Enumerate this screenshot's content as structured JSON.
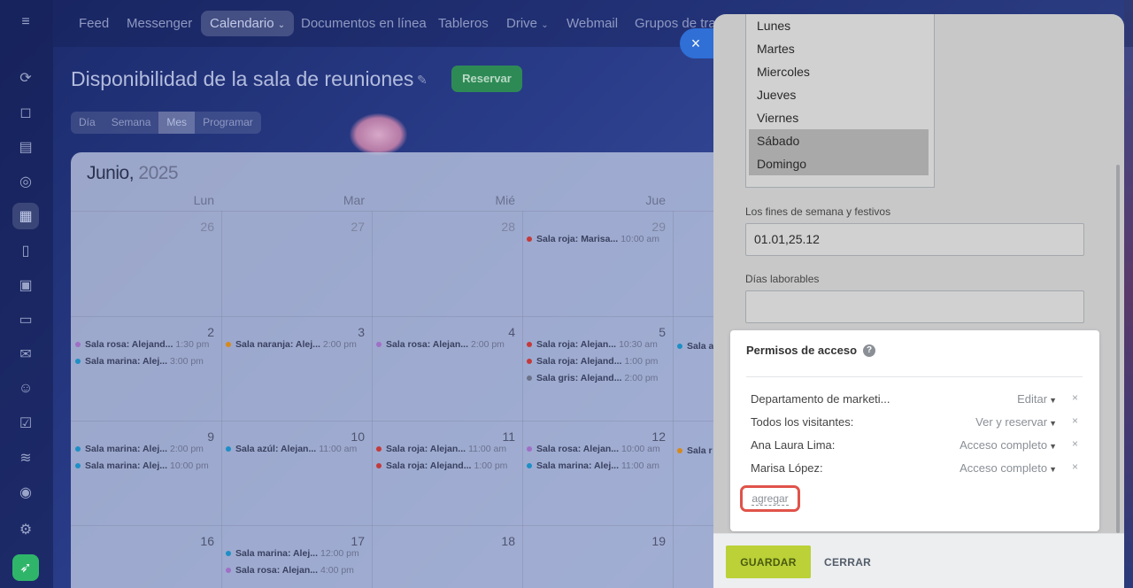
{
  "nav": {
    "items": [
      "Feed",
      "Messenger",
      "Calendario",
      "Documentos en línea",
      "Tableros",
      "Drive",
      "Webmail",
      "Grupos de tra"
    ],
    "active": "Calendario"
  },
  "page": {
    "title": "Disponibilidad de la sala de reuniones",
    "reserve_label": "Reservar",
    "view_tabs": [
      "Día",
      "Semana",
      "Mes",
      "Programar"
    ],
    "active_view": "Mes"
  },
  "calendar": {
    "month": "Junio,",
    "year": "2025",
    "day_headers": [
      "Lun",
      "Mar",
      "Mié",
      "Jue"
    ],
    "colors": {
      "rosa": "#a06fc6",
      "marina": "#1d8fc6",
      "naranja": "#d68a1c",
      "roja": "#c43a3a",
      "azul": "#1d8fc6",
      "gris": "#6a7388"
    },
    "weeks": [
      {
        "days": [
          {
            "num": "26",
            "events": []
          },
          {
            "num": "27",
            "events": []
          },
          {
            "num": "28",
            "events": []
          },
          {
            "num": "29",
            "events": [
              {
                "color": "roja",
                "name": "Sala roja: Marisa...",
                "time": "10:00 am"
              }
            ]
          }
        ]
      },
      {
        "days": [
          {
            "num": "2",
            "events": [
              {
                "color": "rosa",
                "name": "Sala rosa: Alejand...",
                "time": "1:30 pm"
              },
              {
                "color": "marina",
                "name": "Sala marina: Alej...",
                "time": "3:00 pm"
              }
            ]
          },
          {
            "num": "3",
            "events": [
              {
                "color": "naranja",
                "name": "Sala naranja: Alej...",
                "time": "2:00 pm"
              }
            ]
          },
          {
            "num": "4",
            "events": [
              {
                "color": "rosa",
                "name": "Sala rosa: Alejan...",
                "time": "2:00 pm"
              }
            ]
          },
          {
            "num": "5",
            "events": [
              {
                "color": "roja",
                "name": "Sala roja: Alejan...",
                "time": "10:30 am"
              },
              {
                "color": "roja",
                "name": "Sala roja: Alejand...",
                "time": "1:00 pm"
              },
              {
                "color": "gris",
                "name": "Sala gris: Alejand...",
                "time": "2:00 pm"
              }
            ]
          }
        ]
      },
      {
        "days": [
          {
            "num": "9",
            "events": [
              {
                "color": "marina",
                "name": "Sala marina: Alej...",
                "time": "2:00 pm"
              },
              {
                "color": "marina",
                "name": "Sala marina: Alej...",
                "time": "10:00 pm"
              }
            ]
          },
          {
            "num": "10",
            "events": [
              {
                "color": "azul",
                "name": "Sala azúl: Alejan...",
                "time": "11:00 am"
              }
            ]
          },
          {
            "num": "11",
            "events": [
              {
                "color": "roja",
                "name": "Sala roja: Alejan...",
                "time": "11:00 am"
              },
              {
                "color": "roja",
                "name": "Sala roja: Alejand...",
                "time": "1:00 pm"
              }
            ]
          },
          {
            "num": "12",
            "events": [
              {
                "color": "rosa",
                "name": "Sala rosa: Alejan...",
                "time": "10:00 am"
              },
              {
                "color": "marina",
                "name": "Sala marina: Alej...",
                "time": "11:00 am"
              }
            ]
          }
        ]
      },
      {
        "days": [
          {
            "num": "16",
            "events": []
          },
          {
            "num": "17",
            "events": [
              {
                "color": "marina",
                "name": "Sala marina: Alej...",
                "time": "12:00 pm"
              },
              {
                "color": "rosa",
                "name": "Sala rosa: Alejan...",
                "time": "4:00 pm"
              }
            ]
          },
          {
            "num": "18",
            "events": []
          },
          {
            "num": "19",
            "events": []
          }
        ]
      }
    ],
    "partial_col": [
      "Sala a",
      "Sala r"
    ]
  },
  "panel": {
    "weekdays": [
      "Lunes",
      "Martes",
      "Miercoles",
      "Jueves",
      "Viernes",
      "Sábado",
      "Domingo"
    ],
    "selected_weekdays": [
      "Sábado",
      "Domingo"
    ],
    "holidays_label": "Los fines de semana y festivos",
    "holidays_value": "01.01,25.12",
    "workdays_label": "Días laborables",
    "workdays_value": "",
    "permissions": {
      "title": "Permisos de acceso",
      "help": "?",
      "rows": [
        {
          "who": "Departamento de marketi...",
          "level": "Editar"
        },
        {
          "who": "Todos los visitantes:",
          "level": "Ver y reservar"
        },
        {
          "who": "Ana Laura Lima:",
          "level": "Acceso completo"
        },
        {
          "who": "Marisa López:",
          "level": "Acceso completo"
        }
      ],
      "add_label": "agregar"
    },
    "save_label": "GUARDAR",
    "close_label": "CERRAR"
  },
  "icons": {
    "menu": "≡",
    "close": "×",
    "caret": "▼",
    "remove": "×",
    "pin": "✎"
  }
}
